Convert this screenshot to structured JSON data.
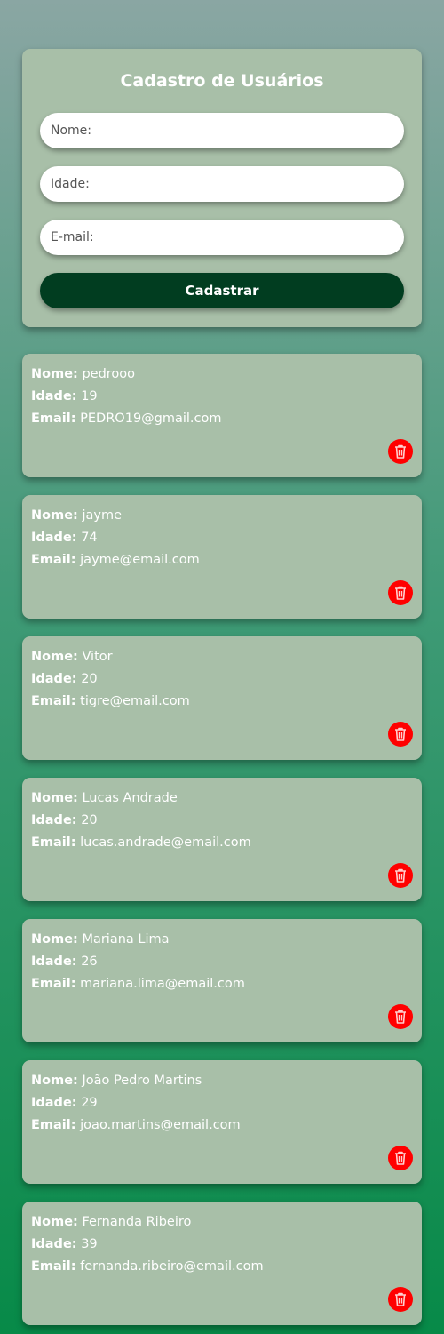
{
  "form": {
    "title": "Cadastro de Usuários",
    "name_placeholder": "Nome:",
    "age_placeholder": "Idade:",
    "email_placeholder": "E-mail:",
    "submit_label": "Cadastrar"
  },
  "labels": {
    "name": "Nome:",
    "age": "Idade:",
    "email": "Email:"
  },
  "users": [
    {
      "name": "pedrooo",
      "age": "19",
      "email": "PEDRO19@gmail.com"
    },
    {
      "name": "jayme",
      "age": "74",
      "email": "jayme@email.com"
    },
    {
      "name": "Vitor",
      "age": "20",
      "email": "tigre@email.com"
    },
    {
      "name": "Lucas Andrade",
      "age": "20",
      "email": "lucas.andrade@email.com"
    },
    {
      "name": "Mariana Lima",
      "age": "26",
      "email": "mariana.lima@email.com"
    },
    {
      "name": "João Pedro Martins",
      "age": "29",
      "email": "joao.martins@email.com"
    },
    {
      "name": "Fernanda Ribeiro",
      "age": "39",
      "email": "fernanda.ribeiro@email.com"
    }
  ],
  "icons": {
    "delete": "trash-icon"
  },
  "colors": {
    "card": "#a8bfa8",
    "button": "#013d20",
    "delete": "#ff0000"
  }
}
